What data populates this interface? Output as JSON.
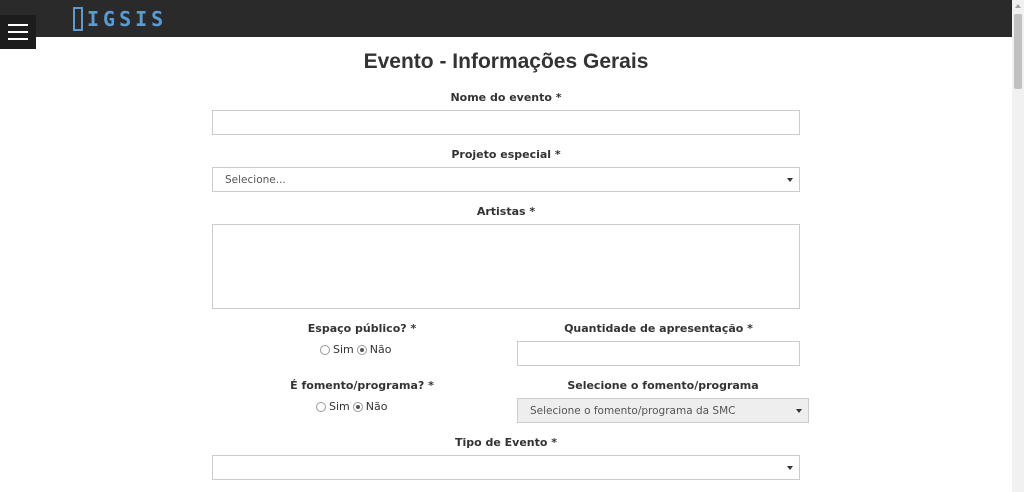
{
  "header": {
    "logo_text": "IGSIS"
  },
  "page": {
    "title": "Evento - Informações Gerais"
  },
  "form": {
    "nome_label": "Nome do evento *",
    "nome_value": "",
    "projeto_label": "Projeto especial *",
    "projeto_selected": "Selecione...",
    "artistas_label": "Artistas *",
    "artistas_value": "",
    "espaco_label": "Espaço público? *",
    "espaco_sim": "Sim",
    "espaco_nao": "Não",
    "quantidade_label": "Quantidade de apresentação *",
    "quantidade_value": "",
    "fomento_label": "É fomento/programa? *",
    "fomento_sim": "Sim",
    "fomento_nao": "Não",
    "selecione_fomento_label": "Selecione o fomento/programa",
    "selecione_fomento_selected": "Selecione o fomento/programa da SMC",
    "tipo_label": "Tipo de Evento *",
    "tipo_selected": ""
  }
}
